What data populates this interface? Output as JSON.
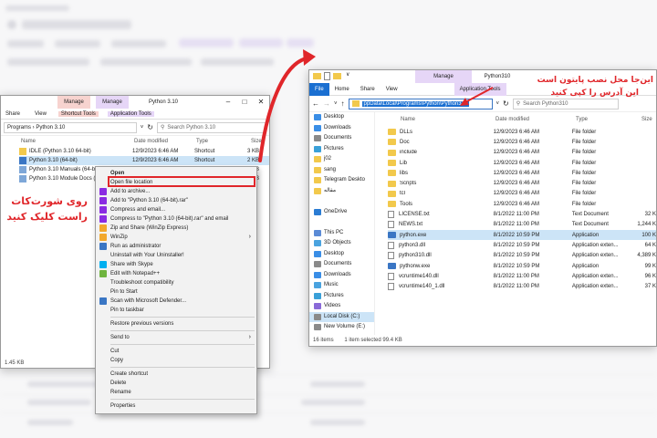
{
  "left_window": {
    "context_tab_manage_1": "Manage",
    "context_tab_manage_2": "Manage",
    "title": "Python 3.10",
    "ribbon_tabs": [
      "Share",
      "View",
      "Shortcut Tools",
      "Application Tools"
    ],
    "address": "Programs  ›  Python 3.10",
    "search_placeholder": "Search Python 3.10",
    "columns": {
      "name": "Name",
      "date": "Date modified",
      "type": "Type",
      "size": "Size"
    },
    "files": [
      {
        "name": "IDLE (Python 3.10 64-bit)",
        "date": "12/9/2023 6:46 AM",
        "type": "Shortcut",
        "size": "3 KB"
      },
      {
        "name": "Python 3.10 (64-bit)",
        "date": "12/9/2023 6:46 AM",
        "type": "Shortcut",
        "size": "2 KB"
      },
      {
        "name": "Python 3.10 Manuals (64-bit)",
        "date": "",
        "type": "",
        "size": "2 KB"
      },
      {
        "name": "Python 3.10 Module Docs (64-bit)",
        "date": "",
        "type": "",
        "size": "2 KB"
      }
    ],
    "status": "1.45 KB",
    "annotation": "روی شورت‌کات\nراست کلیک کنید"
  },
  "context_menu": {
    "items": [
      {
        "label": "Open",
        "bold": true
      },
      {
        "label": "Open file location",
        "highlight": true
      },
      {
        "label": "Add to archive..."
      },
      {
        "label": "Add to \"Python 3.10 (64-bit).rar\""
      },
      {
        "label": "Compress and email..."
      },
      {
        "label": "Compress to \"Python 3.10 (64-bit).rar\" and email"
      },
      {
        "label": "Zip and Share (WinZip Express)"
      },
      {
        "label": "WinZip",
        "submenu": true
      },
      {
        "label": "Run as administrator"
      },
      {
        "label": "Uninstall with Your Uninstaller!"
      },
      {
        "label": "Share with Skype"
      },
      {
        "label": "Edit with Notepad++"
      },
      {
        "label": "Troubleshoot compatibility"
      },
      {
        "label": "Pin to Start"
      },
      {
        "label": "Scan with Microsoft Defender..."
      },
      {
        "label": "Pin to taskbar"
      },
      {
        "sep": true
      },
      {
        "label": "Restore previous versions"
      },
      {
        "sep": true
      },
      {
        "label": "Send to",
        "submenu": true
      },
      {
        "sep": true
      },
      {
        "label": "Cut"
      },
      {
        "label": "Copy"
      },
      {
        "sep": true
      },
      {
        "label": "Create shortcut"
      },
      {
        "label": "Delete"
      },
      {
        "label": "Rename"
      },
      {
        "sep": true
      },
      {
        "label": "Properties"
      }
    ]
  },
  "right_window": {
    "context_tab": "Manage",
    "title": "Python310",
    "ribbon_tabs": [
      "File",
      "Home",
      "Share",
      "View",
      "Application Tools"
    ],
    "address": "ppData\\Local\\Programs\\Python\\Python310",
    "search_placeholder": "Search Python310",
    "columns": {
      "name": "Name",
      "date": "Date modified",
      "type": "Type",
      "size": "Size"
    },
    "nav": [
      {
        "label": "Desktop",
        "color": "#3a8ee6"
      },
      {
        "label": "Downloads",
        "color": "#3a8ee6"
      },
      {
        "label": "Documents",
        "color": "#8a8a8a"
      },
      {
        "label": "Pictures",
        "color": "#3aa0d8"
      },
      {
        "label": "j02",
        "color": "#f2c94c"
      },
      {
        "label": "sang",
        "color": "#f2c94c"
      },
      {
        "label": "Telegram Deskto",
        "color": "#f2c94c"
      },
      {
        "label": "مقاله",
        "color": "#f2c94c"
      },
      {
        "label": "",
        "color": ""
      },
      {
        "label": "OneDrive",
        "color": "#2b7cd3"
      },
      {
        "label": "",
        "color": ""
      },
      {
        "label": "This PC",
        "color": "#5b8bd6"
      },
      {
        "label": "3D Objects",
        "color": "#4aa3df"
      },
      {
        "label": "Desktop",
        "color": "#3a8ee6"
      },
      {
        "label": "Documents",
        "color": "#8a8a8a"
      },
      {
        "label": "Downloads",
        "color": "#3a8ee6"
      },
      {
        "label": "Music",
        "color": "#4aa3df"
      },
      {
        "label": "Pictures",
        "color": "#3aa0d8"
      },
      {
        "label": "Videos",
        "color": "#8a6ad8"
      },
      {
        "label": "Local Disk (C:)",
        "color": "#8a8a8a",
        "selected": true
      },
      {
        "label": "New Volume (E:)",
        "color": "#8a8a8a"
      }
    ],
    "files": [
      {
        "name": "DLLs",
        "date": "12/9/2023 6:46 AM",
        "type": "File folder",
        "size": "",
        "kind": "folder"
      },
      {
        "name": "Doc",
        "date": "12/9/2023 6:46 AM",
        "type": "File folder",
        "size": "",
        "kind": "folder"
      },
      {
        "name": "include",
        "date": "12/9/2023 6:46 AM",
        "type": "File folder",
        "size": "",
        "kind": "folder"
      },
      {
        "name": "Lib",
        "date": "12/9/2023 6:46 AM",
        "type": "File folder",
        "size": "",
        "kind": "folder"
      },
      {
        "name": "libs",
        "date": "12/9/2023 6:46 AM",
        "type": "File folder",
        "size": "",
        "kind": "folder"
      },
      {
        "name": "Scripts",
        "date": "12/9/2023 6:46 AM",
        "type": "File folder",
        "size": "",
        "kind": "folder"
      },
      {
        "name": "tcl",
        "date": "12/9/2023 6:46 AM",
        "type": "File folder",
        "size": "",
        "kind": "folder"
      },
      {
        "name": "Tools",
        "date": "12/9/2023 6:46 AM",
        "type": "File folder",
        "size": "",
        "kind": "folder"
      },
      {
        "name": "LICENSE.txt",
        "date": "8/1/2022 11:00 PM",
        "type": "Text Document",
        "size": "32 K",
        "kind": "doc"
      },
      {
        "name": "NEWS.txt",
        "date": "8/1/2022 11:00 PM",
        "type": "Text Document",
        "size": "1,244 K",
        "kind": "doc"
      },
      {
        "name": "python.exe",
        "date": "8/1/2022 10:59 PM",
        "type": "Application",
        "size": "100 K",
        "kind": "app",
        "selected": true
      },
      {
        "name": "python3.dll",
        "date": "8/1/2022 10:59 PM",
        "type": "Application exten...",
        "size": "64 K",
        "kind": "doc"
      },
      {
        "name": "python310.dll",
        "date": "8/1/2022 10:59 PM",
        "type": "Application exten...",
        "size": "4,389 K",
        "kind": "doc"
      },
      {
        "name": "pythonw.exe",
        "date": "8/1/2022 10:59 PM",
        "type": "Application",
        "size": "99 K",
        "kind": "app"
      },
      {
        "name": "vcruntime140.dll",
        "date": "8/1/2022 11:00 PM",
        "type": "Application exten...",
        "size": "96 K",
        "kind": "doc"
      },
      {
        "name": "vcruntime140_1.dll",
        "date": "8/1/2022 11:00 PM",
        "type": "Application exten...",
        "size": "37 K",
        "kind": "doc"
      }
    ],
    "status": {
      "count": "16 items",
      "selected": "1 item selected  99.4 KB"
    },
    "annotation_line1": "این‌جا محل نصب پایتون است",
    "annotation_line2": "این آدرس را کپی کنید"
  },
  "colors": {
    "accent": "#e0262a",
    "manage_purple": "#e6d6f7",
    "manage_pink": "#f7d3cf",
    "file_blue": "#1a6fd1"
  }
}
